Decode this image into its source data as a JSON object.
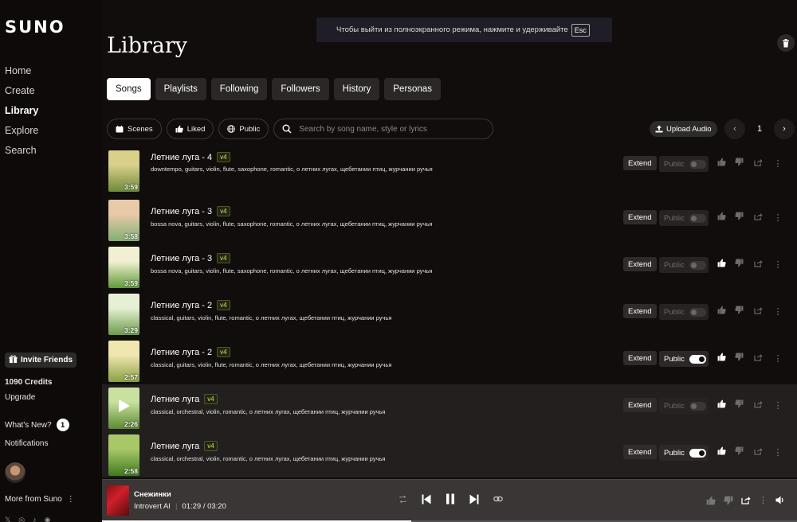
{
  "sidebar": {
    "logo": "SUNO",
    "nav": [
      "Home",
      "Create",
      "Library",
      "Explore",
      "Search"
    ],
    "active": "Library",
    "invite": "Invite Friends",
    "credits": "1090 Credits",
    "upgrade": "Upgrade",
    "whats_new": "What's New?",
    "whats_new_count": "1",
    "notifications": "Notifications",
    "more": "More from Suno"
  },
  "toast": {
    "text": "Чтобы выйти из полноэкранного режима, нажмите и удерживайте",
    "key": "Esc"
  },
  "page": {
    "title": "Library"
  },
  "tabs": [
    "Songs",
    "Playlists",
    "Following",
    "Followers",
    "History",
    "Personas"
  ],
  "filters": {
    "scenes": "Scenes",
    "liked": "Liked",
    "public": "Public",
    "search_placeholder": "Search by song name, style or lyrics",
    "upload": "Upload Audio",
    "page": "1"
  },
  "songs": [
    {
      "title": "Летние луга - 4",
      "version": "v4",
      "duration": "3:59",
      "tags": "downtempo, guitars, violin, flute, saxophone, romantic, о летних лугах, щебетании птиц, журчании ручья",
      "extend": "Extend",
      "public": "Public",
      "is_public": false,
      "liked": false,
      "colors": [
        "#d9d08a",
        "#6c8a3a"
      ]
    },
    {
      "title": "Летние луга - 3",
      "version": "v4",
      "duration": "3:58",
      "tags": "bossa nova, guitars, violin, flute, saxophone, romantic, о летних лугах, щебетании птиц, журчании ручья",
      "extend": "Extend",
      "public": "Public",
      "is_public": false,
      "liked": false,
      "colors": [
        "#e8c9a8",
        "#7fb070"
      ]
    },
    {
      "title": "Летние луга - 3",
      "version": "v4",
      "duration": "3:59",
      "tags": "bossa nova, guitars, violin, flute, saxophone, romantic, о летних лугах, щебетании птиц, журчании ручья",
      "extend": "Extend",
      "public": "Public",
      "is_public": false,
      "liked": true,
      "colors": [
        "#f2f0d2",
        "#5f9a3a"
      ]
    },
    {
      "title": "Летние луга - 2",
      "version": "v4",
      "duration": "3:29",
      "tags": "classical, guitars, violin, flute, romantic, о летних лугах, щебетании птиц, журчании ручья",
      "extend": "Extend",
      "public": "Public",
      "is_public": false,
      "liked": false,
      "colors": [
        "#e6f0d4",
        "#6a9a4a"
      ]
    },
    {
      "title": "Летние луга - 2",
      "version": "v4",
      "duration": "2:57",
      "tags": "classical, guitars, violin, flute, romantic, о летних лугах, щебетании птиц, журчании ручья",
      "extend": "Extend",
      "public": "Public",
      "is_public": true,
      "liked": true,
      "colors": [
        "#f0e6b0",
        "#8aa040"
      ]
    },
    {
      "title": "Летние луга",
      "version": "v4",
      "duration": "2:26",
      "tags": "classical, orchestral, violin, romantic, о летних лугах, щебетании птиц, журчании ручья",
      "extend": "Extend",
      "public": "Public",
      "is_public": false,
      "liked": true,
      "colors": [
        "#c8e0a0",
        "#5a8a30"
      ]
    },
    {
      "title": "Летние луга",
      "version": "v4",
      "duration": "2:58",
      "tags": "classical, orchestral, violin, romantic, о летних лугах, щебетании птиц, журчании ручья",
      "extend": "Extend",
      "public": "Public",
      "is_public": true,
      "liked": true,
      "colors": [
        "#a8c868",
        "#3f7a20"
      ]
    }
  ],
  "player": {
    "title": "Снежинки",
    "artist": "Introvert AI",
    "time": "01:29 / 03:20",
    "progress": 0.445
  }
}
